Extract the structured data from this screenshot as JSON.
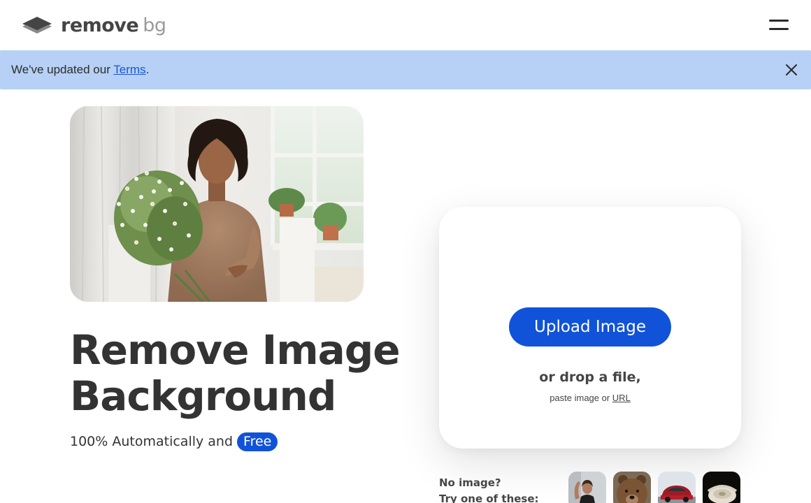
{
  "header": {
    "logo_word1": "remove",
    "logo_word2": "bg",
    "menu_icon": "hamburger-icon"
  },
  "banner": {
    "prefix": "We've updated our ",
    "link_label": "Terms",
    "suffix": ".",
    "close_icon": "close-icon",
    "background": "#b6d1f5"
  },
  "hero": {
    "image_icon": "woman-with-flowers-photo",
    "title_line1": "Remove Image",
    "title_line2": "Background",
    "subtitle_prefix": "100% Automatically and",
    "subtitle_badge": "Free"
  },
  "upload": {
    "button_label": "Upload Image",
    "drop_text": "or drop a file,",
    "paste_prefix": "paste image or ",
    "url_link": "URL"
  },
  "samples": {
    "line1": "No image?",
    "line2": "Try one of these:",
    "items": [
      {
        "name": "sample-woman-icon"
      },
      {
        "name": "sample-bear-icon"
      },
      {
        "name": "sample-car-icon"
      },
      {
        "name": "sample-phone-icon"
      }
    ]
  },
  "colors": {
    "accent": "#1153d8",
    "text": "#454545",
    "banner": "#b6d1f5"
  }
}
